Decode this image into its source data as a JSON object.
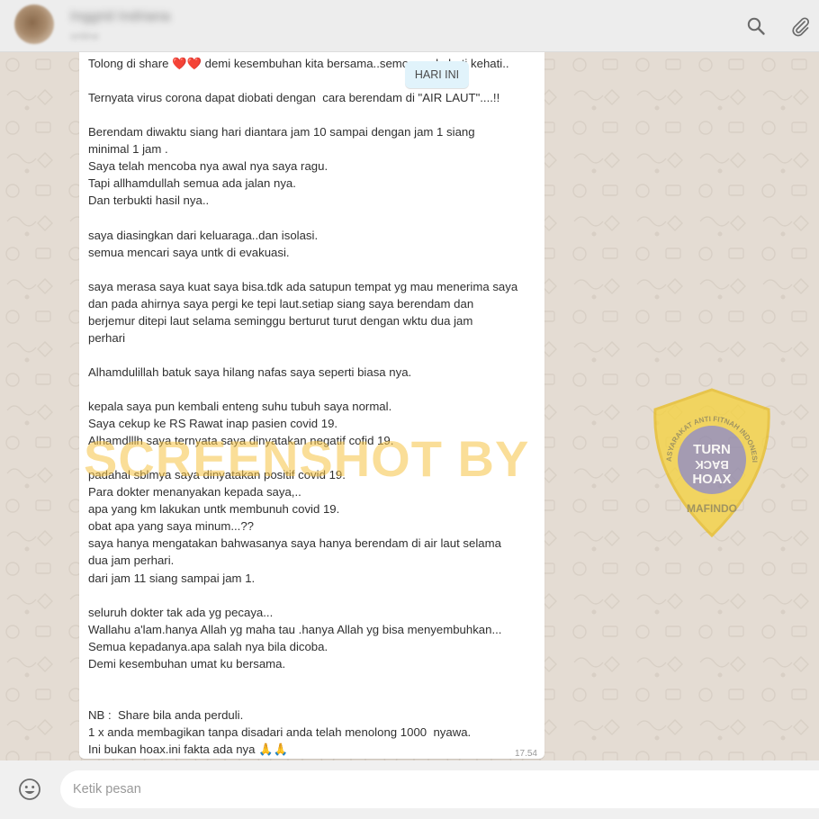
{
  "header": {
    "contact_name": "Inggrid Indriana",
    "contact_status": "online",
    "icons": [
      "search-icon",
      "attach-icon"
    ]
  },
  "chat": {
    "date_chip": "HARI INI",
    "timestamp": "17.54",
    "message_lines": [
      "Tolong di share ❤️❤️ demi kesembuhan kita bersama..semoga ada hati kehati..",
      "",
      "Ternyata virus corona dapat diobati dengan  cara berendam di \"AIR LAUT\"....!!",
      "",
      "Berendam diwaktu siang hari diantara jam 10 sampai dengan jam 1 siang",
      "minimal 1 jam .",
      "Saya telah mencoba nya awal nya saya ragu.",
      "Tapi allhamdullah semua ada jalan nya.",
      "Dan terbukti hasil nya..",
      "",
      "saya diasingkan dari keluaraga..dan isolasi.",
      "semua mencari saya untk di evakuasi.",
      "",
      "saya merasa saya kuat saya bisa.tdk ada satupun tempat yg mau menerima saya",
      "dan pada ahirnya saya pergi ke tepi laut.setiap siang saya berendam dan",
      "berjemur ditepi laut selama seminggu berturut turut dengan wktu dua jam",
      "perhari",
      "",
      "Alhamdulillah batuk saya hilang nafas saya seperti biasa nya.",
      "",
      "kepala saya pun kembali enteng suhu tubuh saya normal.",
      "Saya cekup ke RS Rawat inap pasien covid 19.",
      "Alhamdlllh saya ternyata saya dinyatakan negatif cofid 19.",
      "",
      "padahal sblmya saya dinyatakan positif covid 19.",
      "Para dokter menanyakan kepada saya,..",
      "apa yang km lakukan untk membunuh covid 19.",
      "obat apa yang saya minum...??",
      "saya hanya mengatakan bahwasanya saya hanya berendam di air laut selama",
      "dua jam perhari.",
      "dari jam 11 siang sampai jam 1.",
      "",
      "seluruh dokter tak ada yg pecaya...",
      "Wallahu a'lam.hanya Allah yg maha tau .hanya Allah yg bisa menyembuhkan...",
      "Semua kepadanya.apa salah nya bila dicoba.",
      "Demi kesembuhan umat ku bersama.",
      "",
      "",
      "NB :  Share bila anda perduli.",
      "1 x anda membagikan tanpa disadari anda telah menolong 1000  nyawa.",
      "Ini bukan hoax.ini fakta ada nya 🙏🙏"
    ]
  },
  "watermark": {
    "text": "SCREENSHOT BY",
    "badge_top": "TURN",
    "badge_mid": "BACK",
    "badge_bottom": "HOAX",
    "badge_ring": "MASYARAKAT ANTI FITNAH INDONESIA",
    "badge_name": "MAFINDO",
    "color": "#f6c445"
  },
  "footer": {
    "input_placeholder": "Ketik pesan",
    "icons": [
      "emoji-icon"
    ]
  }
}
